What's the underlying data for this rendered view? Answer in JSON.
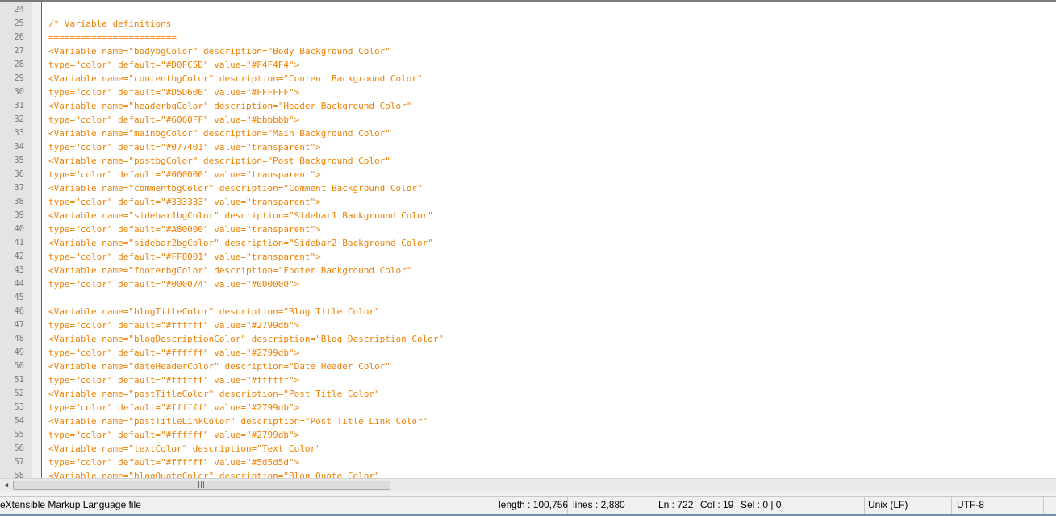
{
  "editor": {
    "lines": [
      {
        "num": "24",
        "text": ""
      },
      {
        "num": "25",
        "text": "/* Variable definitions"
      },
      {
        "num": "26",
        "text": "========================"
      },
      {
        "num": "27",
        "text": "<Variable name=\"bodybgColor\" description=\"Body Background Color\""
      },
      {
        "num": "28",
        "text": "type=\"color\" default=\"#D0FC5D\" value=\"#F4F4F4\">"
      },
      {
        "num": "29",
        "text": "<Variable name=\"contentbgColor\" description=\"Content Background Color\""
      },
      {
        "num": "30",
        "text": "type=\"color\" default=\"#D5D600\" value=\"#FFFFFF\">"
      },
      {
        "num": "31",
        "text": "<Variable name=\"headerbgColor\" description=\"Header Background Color\""
      },
      {
        "num": "32",
        "text": "type=\"color\" default=\"#6060FF\" value=\"#bbbbbb\">"
      },
      {
        "num": "33",
        "text": "<Variable name=\"mainbgColor\" description=\"Main Background Color\""
      },
      {
        "num": "34",
        "text": "type=\"color\" default=\"#077401\" value=\"transparent\">"
      },
      {
        "num": "35",
        "text": "<Variable name=\"postbgColor\" description=\"Post Background Color\""
      },
      {
        "num": "36",
        "text": "type=\"color\" default=\"#000000\" value=\"transparent\">"
      },
      {
        "num": "37",
        "text": "<Variable name=\"commentbgColor\" description=\"Comment Background Color\""
      },
      {
        "num": "38",
        "text": "type=\"color\" default=\"#333333\" value=\"transparent\">"
      },
      {
        "num": "39",
        "text": "<Variable name=\"sidebar1bgColor\" description=\"Sidebar1 Background Color\""
      },
      {
        "num": "40",
        "text": "type=\"color\" default=\"#A80000\" value=\"transparent\">"
      },
      {
        "num": "41",
        "text": "<Variable name=\"sidebar2bgColor\" description=\"Sidebar2 Background Color\""
      },
      {
        "num": "42",
        "text": "type=\"color\" default=\"#FF8001\" value=\"transparent\">"
      },
      {
        "num": "43",
        "text": "<Variable name=\"footerbgColor\" description=\"Footer Background Color\""
      },
      {
        "num": "44",
        "text": "type=\"color\" default=\"#000074\" value=\"#000000\">"
      },
      {
        "num": "45",
        "text": ""
      },
      {
        "num": "46",
        "text": "<Variable name=\"blogTitleColor\" description=\"Blog Title Color\""
      },
      {
        "num": "47",
        "text": "type=\"color\" default=\"#ffffff\" value=\"#2799db\">"
      },
      {
        "num": "48",
        "text": "<Variable name=\"blogDescriptionColor\" description=\"Blog Description Color\""
      },
      {
        "num": "49",
        "text": "type=\"color\" default=\"#ffffff\" value=\"#2799db\">"
      },
      {
        "num": "50",
        "text": "<Variable name=\"dateHeaderColor\" description=\"Date Header Color\""
      },
      {
        "num": "51",
        "text": "type=\"color\" default=\"#ffffff\" value=\"#ffffff\">"
      },
      {
        "num": "52",
        "text": "<Variable name=\"postTitleColor\" description=\"Post Title Color\""
      },
      {
        "num": "53",
        "text": "type=\"color\" default=\"#ffffff\" value=\"#2799db\">"
      },
      {
        "num": "54",
        "text": "<Variable name=\"postTitleLinkColor\" description=\"Post Title Link Color\""
      },
      {
        "num": "55",
        "text": "type=\"color\" default=\"#ffffff\" value=\"#2799db\">"
      },
      {
        "num": "56",
        "text": "<Variable name=\"textColor\" description=\"Text Color\""
      },
      {
        "num": "57",
        "text": "type=\"color\" default=\"#ffffff\" value=\"#5d5d5d\">"
      },
      {
        "num": "58",
        "text": "<Variable name=\"blogQuoteColor\" description=\"Blog Quote Color\""
      }
    ]
  },
  "scrollbar": {
    "left_arrow": "◀",
    "grip": "|||"
  },
  "status": {
    "file_type": "eXtensible Markup Language file",
    "length": "length : 100,756",
    "lines": "lines : 2,880",
    "ln": "Ln : 722",
    "col": "Col : 19",
    "sel": "Sel : 0 | 0",
    "eol": "Unix (LF)",
    "encoding": "UTF-8"
  },
  "colors": {
    "code_text": "#f08000",
    "gutter": "#e4e4e4",
    "fold_line": "#e03030"
  }
}
